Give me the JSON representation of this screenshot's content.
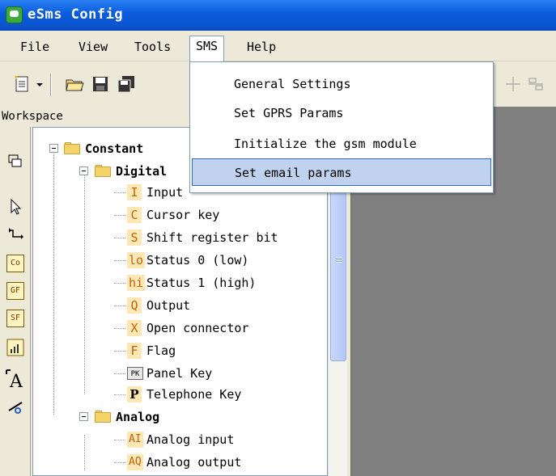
{
  "window": {
    "title": "eSms Config"
  },
  "menubar": {
    "items": [
      "File",
      "View",
      "Tools",
      "SMS",
      "Help"
    ],
    "active": "SMS"
  },
  "workspace": {
    "title": "Workspace"
  },
  "sms_menu": {
    "items": [
      "General Settings",
      "Set GPRS Params",
      "Initialize the gsm module",
      "Set email params"
    ],
    "highlighted": "Set email params"
  },
  "tree": {
    "constant": "Constant",
    "digital": "Digital",
    "digital_items": [
      {
        "badge": "I",
        "label": "Input"
      },
      {
        "badge": "C",
        "label": "Cursor key"
      },
      {
        "badge": "S",
        "label": "Shift register bit"
      },
      {
        "badge": "lo",
        "label": "Status 0 (low)"
      },
      {
        "badge": "hi",
        "label": "Status 1 (high)"
      },
      {
        "badge": "Q",
        "label": "Output"
      },
      {
        "badge": "X",
        "label": "Open connector"
      },
      {
        "badge": "F",
        "label": "Flag"
      },
      {
        "badge": "PK",
        "label": "Panel Key"
      },
      {
        "badge": "P",
        "label": "Telephone Key"
      }
    ],
    "analog": "Analog",
    "analog_items": [
      {
        "badge": "AI",
        "label": "Analog input"
      },
      {
        "badge": "AQ",
        "label": "Analog output"
      }
    ]
  },
  "palette": {
    "items": [
      "Co",
      "GF",
      "SF"
    ],
    "icons": [
      "window-icon",
      "pointer-icon",
      "connect-icon",
      "co-icon",
      "gf-icon",
      "sf-icon",
      "signal-icon",
      "text-icon",
      "cut-icon"
    ]
  }
}
